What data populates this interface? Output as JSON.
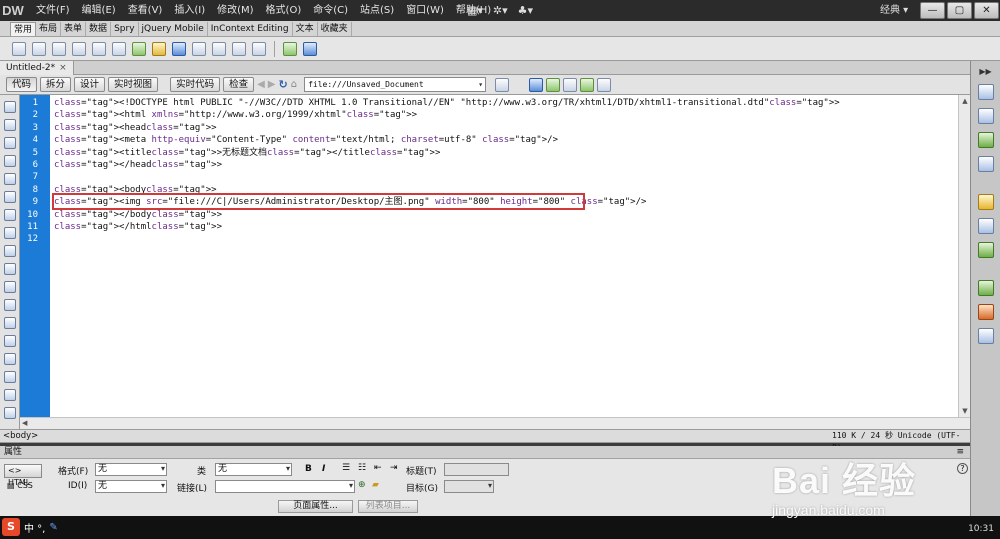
{
  "app": {
    "logo": "DW",
    "workspace": "经典 ▾"
  },
  "menu": [
    "文件(F)",
    "编辑(E)",
    "查看(V)",
    "插入(I)",
    "修改(M)",
    "格式(O)",
    "命令(C)",
    "站点(S)",
    "窗口(W)",
    "帮助(H)"
  ],
  "window_buttons": [
    "—",
    "▢",
    "✕"
  ],
  "insert_tabs": [
    "常用",
    "布局",
    "表单",
    "数据",
    "Spry",
    "jQuery Mobile",
    "InContext Editing",
    "文本",
    "收藏夹"
  ],
  "document": {
    "tab_label": "Untitled-2*",
    "tab_close": "×",
    "view_buttons": [
      "代码",
      "拆分",
      "设计",
      "实时视图"
    ],
    "live_code": "实时代码",
    "inspect": "检查",
    "url": "file:///Unsaved_Document"
  },
  "code": {
    "line_numbers": [
      "1",
      "2",
      "3",
      "4",
      "5",
      "6",
      "7",
      "8",
      "9",
      "10",
      "11",
      "12"
    ],
    "lines": [
      "<!DOCTYPE html PUBLIC \"-//W3C//DTD XHTML 1.0 Transitional//EN\" \"http://www.w3.org/TR/xhtml1/DTD/xhtml1-transitional.dtd\">",
      "<html xmlns=\"http://www.w3.org/1999/xhtml\">",
      "<head>",
      "<meta http-equiv=\"Content-Type\" content=\"text/html; charset=utf-8\" />",
      "<title>无标题文档</title>",
      "</head>",
      "",
      "<body>",
      "<img src=\"file:///C|/Users/Administrator/Desktop/主图.png\" width=\"800\" height=\"800\" />",
      "</body>",
      "</html>",
      ""
    ]
  },
  "status": {
    "tag_selector": "<body>",
    "right": "110 K / 24 秒 Unicode (UTF-8)"
  },
  "properties": {
    "header": "属性",
    "html_btn": "HTML",
    "css_btn": "CSS",
    "format_label": "格式(F)",
    "format_value": "无",
    "class_label": "类",
    "class_value": "无",
    "id_label": "ID(I)",
    "id_value": "无",
    "link_label": "链接(L)",
    "link_value": "",
    "title_label": "标题(T)",
    "target_label": "目标(G)",
    "bold": "B",
    "italic": "I",
    "page_props": "页面属性...",
    "list_item": "列表项目..."
  },
  "taskbar": {
    "ime_text": "中 °, ",
    "clock": "10:31"
  },
  "watermark": {
    "brand": "Bai 经验",
    "url": "jingyan.baidu.com"
  }
}
